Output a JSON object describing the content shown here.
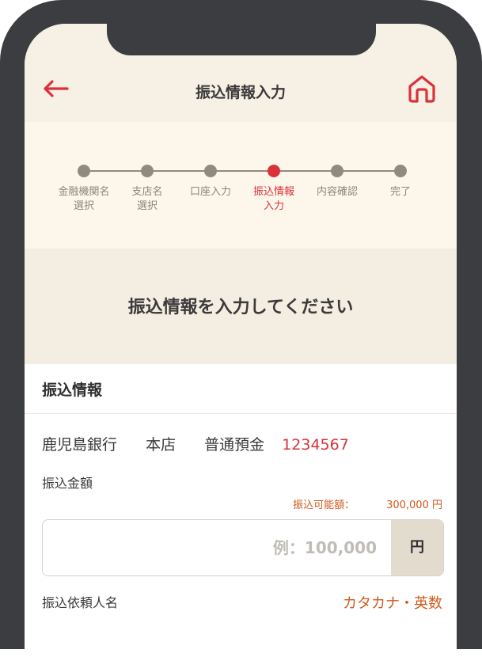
{
  "header": {
    "title": "振込情報入力",
    "back_icon": "arrow-left-icon",
    "home_icon": "home-icon",
    "accent": "#d9323a"
  },
  "steps": [
    {
      "label": "金融機関名\n選択",
      "active": false
    },
    {
      "label": "支店名\n選択",
      "active": false
    },
    {
      "label": "口座入力",
      "active": false
    },
    {
      "label": "振込情報\n入力",
      "active": true
    },
    {
      "label": "内容確認",
      "active": false
    },
    {
      "label": "完了",
      "active": false
    }
  ],
  "headline": "振込情報を入力してください",
  "transfer": {
    "section_title": "振込情報",
    "bank": "鹿児島銀行",
    "branch": "本店",
    "account_type": "普通預金",
    "account_number": "1234567",
    "amount_label": "振込金額",
    "available_label": "振込可能額：",
    "available_value": "300,000 円",
    "amount_placeholder": "例：100,000",
    "amount_value": "",
    "currency": "円",
    "requester_label": "振込依頼人名",
    "requester_hint": "カタカナ・英数"
  }
}
